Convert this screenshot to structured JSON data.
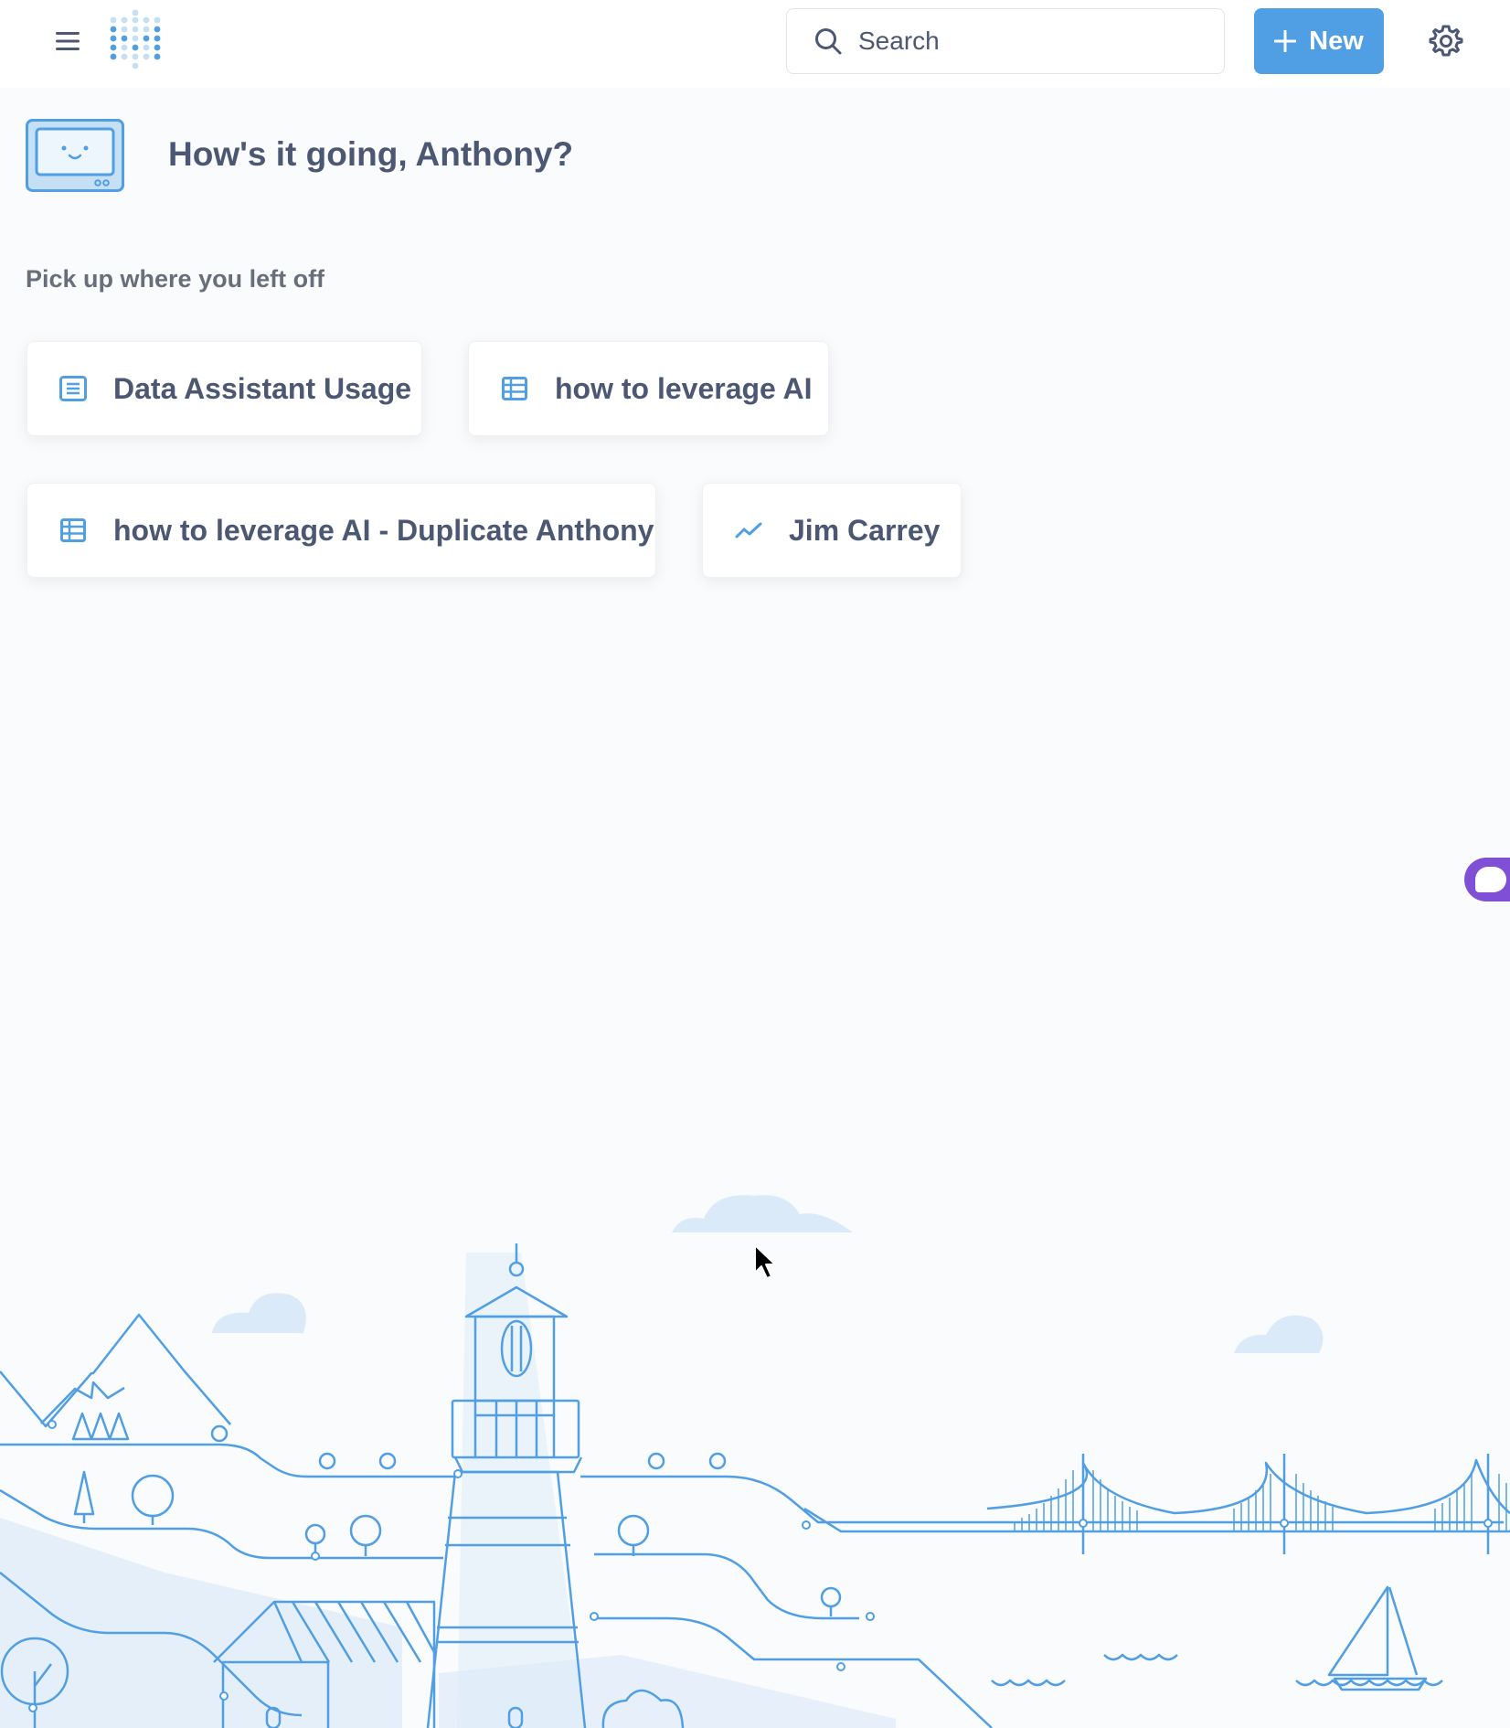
{
  "header": {
    "search_placeholder": "Search",
    "new_label": "New",
    "icons": [
      "hamburger-icon",
      "logo-icon",
      "search-icon",
      "plus-icon",
      "gear-icon"
    ]
  },
  "greeting": {
    "text": "How's it going, Anthony?"
  },
  "recents": {
    "title": "Pick up where you left off",
    "items": [
      {
        "label": "Data Assistant Usage",
        "icon": "document-icon"
      },
      {
        "label": "how to leverage AI",
        "icon": "table-icon"
      },
      {
        "label": "how to leverage AI - Duplicate Anthony",
        "icon": "table-icon"
      },
      {
        "label": "Jim Carrey",
        "icon": "line-chart-icon"
      }
    ]
  },
  "colors": {
    "brand": "#509ee3",
    "text": "#4c5773",
    "chat_accent": "#7f4fd6",
    "illustration": "#509ee3"
  }
}
